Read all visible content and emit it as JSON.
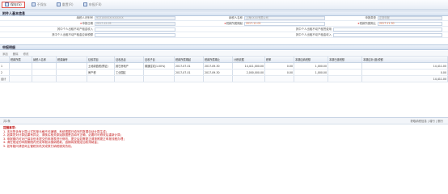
{
  "toolbar": {
    "buttons": [
      {
        "label": "保存(S)",
        "icon": "save-icon"
      },
      {
        "label": "不保存",
        "icon": "discard-icon"
      },
      {
        "label": "重置(R)",
        "icon": "reset-icon"
      },
      {
        "label": "申报(F8)",
        "icon": "declare-icon"
      }
    ]
  },
  "sections": {
    "basic_info": "附件人基本信息",
    "detail": "申报明细"
  },
  "form": {
    "fields": [
      {
        "label": "纳税人识别号",
        "value": "91310000XXXXXXXX",
        "gray": true,
        "required": false
      },
      {
        "label": "纳税人名称",
        "value": "上海XXXX有限公司",
        "gray": true,
        "required": false
      },
      {
        "label": "申报类型",
        "value": "正常申报",
        "gray": true,
        "required": false
      },
      {
        "label": "申报日期",
        "value": "2017-12-05",
        "gray": true,
        "required": true
      },
      {
        "label": "税款所属期起",
        "value": "2017-11-01",
        "gray": false,
        "required": true
      },
      {
        "label": "税款所属期止",
        "value": "2017-11-30",
        "gray": false,
        "required": true
      },
      {
        "label": "其中个人出租不动产租金收入",
        "value": "",
        "gray": false,
        "required": false
      },
      {
        "label": "其中个人出租不动产租赁费用",
        "value": "",
        "gray": false,
        "required": false
      },
      {
        "label": "其中个人出租不动产租金应纳税额",
        "value": "",
        "gray": false,
        "required": false
      },
      {
        "label": "其中个人出租不动产租金收入",
        "value": "",
        "gray": false,
        "required": false
      }
    ]
  },
  "grid": {
    "tools": [
      "添加",
      "删除",
      "修改"
    ],
    "columns": [
      "",
      "税款所属",
      "纳税人名称",
      "税源编号",
      "征收项目",
      "征收品目",
      "征收子目",
      "税款所属期起",
      "税款所属期止",
      "计税依据",
      "税率",
      "本期应纳税额",
      "本期已缴税额",
      "本期应补(退)税额"
    ],
    "rows": [
      [
        "1",
        "",
        "",
        "",
        "土地增值税(预征)",
        "其它房地产",
        "普通住宅(1.00%)",
        "2017-07-01",
        "2017-09-30",
        "14,411,000.00",
        "0.00",
        "1,000.00",
        "",
        "14,411.00"
      ],
      [
        "2",
        "",
        "",
        "",
        "房产税",
        "工业园区",
        "",
        "2017-07-01",
        "2017-09-30",
        "2,000,000.00",
        "0.00",
        "1,000.00",
        "",
        "0.00"
      ],
      [
        "合计",
        "",
        "",
        "",
        "",
        "",
        "",
        "",
        "",
        "",
        "",
        "",
        "",
        "14,411.00"
      ]
    ]
  },
  "pager": {
    "left": "共2条",
    "right": "获取纳税信息  |  增行  |  删行"
  },
  "notes": {
    "title": "提醒事项：",
    "lines": [
      "1. 本页签含有计算公式的单元格不可编辑，系统根据已填写的数据自动计算生成；",
      "2. 如果您对计算结果有异议，请核实相关原始数据是否填写正确，必要时可修改后重新计算；",
      "3. 申报期内可对已保存但未提交的申报表进行修改，提交后如需更正请按照更正申报流程办理；",
      "4. 请在规定的申报期限内完成申报并缴纳税款，逾期将按规定加收滞纳金；",
      "5. 如有疑问请咨询主管税务机关或拨打纳税服务热线。"
    ]
  },
  "colors": {
    "accent": "#e0534b",
    "header": "#d8e3f1",
    "note": "#c21d1d"
  }
}
